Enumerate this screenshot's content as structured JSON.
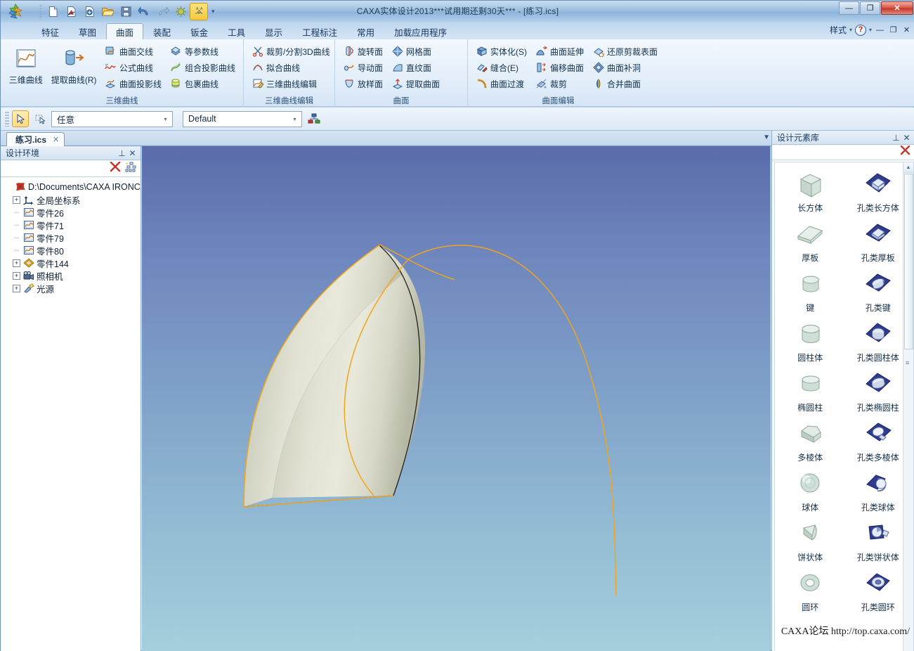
{
  "window": {
    "title": "CAXA实体设计2013***试用期还剩30天*** - [练习.ics]",
    "minimize": "—",
    "maximize": "❐",
    "close": "✕"
  },
  "quick_access": {
    "items": [
      {
        "name": "new-document-icon",
        "tip": "新建"
      },
      {
        "name": "new-part-icon",
        "tip": "新建零件"
      },
      {
        "name": "new-drawing-icon",
        "tip": "新建图纸"
      },
      {
        "name": "open-icon",
        "tip": "打开"
      },
      {
        "name": "save-icon",
        "tip": "保存"
      },
      {
        "name": "undo-icon",
        "tip": "撤销"
      },
      {
        "name": "redo-icon",
        "tip": "重做"
      },
      {
        "name": "render-icon",
        "tip": "渲染"
      },
      {
        "name": "smart-dimension-icon",
        "tip": "智能标注"
      }
    ],
    "more": "▾"
  },
  "ribbon": {
    "tabs": [
      {
        "label": "特征",
        "active": false
      },
      {
        "label": "草图",
        "active": false
      },
      {
        "label": "曲面",
        "active": true
      },
      {
        "label": "装配",
        "active": false
      },
      {
        "label": "钣金",
        "active": false
      },
      {
        "label": "工具",
        "active": false
      },
      {
        "label": "显示",
        "active": false
      },
      {
        "label": "工程标注",
        "active": false
      },
      {
        "label": "常用",
        "active": false
      },
      {
        "label": "加载应用程序",
        "active": false
      }
    ],
    "right": {
      "style_label": "样式",
      "style_arrow": "▾",
      "help_glyph": "?",
      "help_arrow": "▾",
      "min": "—",
      "restore": "❐",
      "close": "✕"
    },
    "groups": [
      {
        "title": "三维曲线",
        "big": [
          {
            "label": "三维曲线",
            "icon": "curve3d-icon"
          },
          {
            "label": "提取曲线(R)",
            "icon": "extract-curve-icon"
          }
        ],
        "cols": [
          [
            {
              "label": "曲面交线",
              "icon": "surface-intersect-icon"
            },
            {
              "label": "公式曲线",
              "icon": "formula-curve-icon"
            },
            {
              "label": "曲面投影线",
              "icon": "surface-projection-icon"
            }
          ],
          [
            {
              "label": "等参数线",
              "icon": "isoparm-icon"
            },
            {
              "label": "组合投影曲线",
              "icon": "combined-projection-icon"
            },
            {
              "label": "包裹曲线",
              "icon": "wrap-curve-icon"
            }
          ]
        ]
      },
      {
        "title": "三维曲线编辑",
        "big": [],
        "cols": [
          [
            {
              "label": "裁剪/分割3D曲线",
              "icon": "trim-split-3d-icon"
            },
            {
              "label": "拟合曲线",
              "icon": "fit-curve-icon"
            },
            {
              "label": "三维曲线编辑",
              "icon": "edit-3d-curve-icon"
            }
          ]
        ]
      },
      {
        "title": "曲面",
        "big": [],
        "cols": [
          [
            {
              "label": "旋转面",
              "icon": "revolve-surface-icon"
            },
            {
              "label": "导动面",
              "icon": "sweep-surface-icon"
            },
            {
              "label": "放样面",
              "icon": "loft-surface-icon"
            }
          ],
          [
            {
              "label": "网格面",
              "icon": "mesh-surface-icon"
            },
            {
              "label": "直纹面",
              "icon": "ruled-surface-icon"
            },
            {
              "label": "提取曲面",
              "icon": "extract-surface-icon"
            }
          ]
        ]
      },
      {
        "title": "曲面编辑",
        "big": [],
        "cols": [
          [
            {
              "label": "实体化(S)",
              "icon": "solidify-icon"
            },
            {
              "label": "缝合(E)",
              "icon": "stitch-icon"
            },
            {
              "label": "曲面过渡",
              "icon": "surface-blend-icon"
            }
          ],
          [
            {
              "label": "曲面延伸",
              "icon": "extend-surface-icon"
            },
            {
              "label": "偏移曲面",
              "icon": "offset-surface-icon"
            },
            {
              "label": "裁剪",
              "icon": "trim-icon"
            }
          ],
          [
            {
              "label": "还原剪裁表面",
              "icon": "untrim-surface-icon"
            },
            {
              "label": "曲面补洞",
              "icon": "patch-hole-icon"
            },
            {
              "label": "合并曲面",
              "icon": "merge-surface-icon"
            }
          ]
        ]
      }
    ]
  },
  "select_toolbar": {
    "pointer_icon": "arrow-select-icon",
    "box_icon": "box-select-icon",
    "filter": {
      "value": "任意",
      "arrow": "▾"
    },
    "style": {
      "value": "Default",
      "arrow": "▾"
    },
    "network_icon": "assembly-tree-icon"
  },
  "doc_tabs": {
    "tabs": [
      {
        "label": "练习.ics",
        "close": "✕",
        "active": true
      }
    ],
    "dropdown": "▼"
  },
  "left_panel": {
    "title": "设计环境",
    "pin": "⊥",
    "close": "✕",
    "toolbar": [
      {
        "name": "delete-icon",
        "glyph": "✕"
      },
      {
        "name": "tree-structure-icon",
        "glyph": "⁂"
      }
    ],
    "tree": [
      {
        "label": "D:\\Documents\\CAXA IRONC/",
        "level": 0,
        "expander": "",
        "icon": "root-design-icon"
      },
      {
        "label": "全局坐标系",
        "level": 1,
        "expander": "+",
        "icon": "coordinate-system-icon"
      },
      {
        "label": "零件26",
        "level": 1,
        "expander": "",
        "icon": "part-curve-icon"
      },
      {
        "label": "零件71",
        "level": 1,
        "expander": "",
        "icon": "part-curve-icon"
      },
      {
        "label": "零件79",
        "level": 1,
        "expander": "",
        "icon": "part-curve-icon"
      },
      {
        "label": "零件80",
        "level": 1,
        "expander": "",
        "icon": "part-curve-icon"
      },
      {
        "label": "零件144",
        "level": 1,
        "expander": "+",
        "icon": "surface-part-icon"
      },
      {
        "label": "照相机",
        "level": 1,
        "expander": "+",
        "icon": "camera-icon"
      },
      {
        "label": "光源",
        "level": 1,
        "expander": "+",
        "icon": "light-icon"
      }
    ]
  },
  "right_panel": {
    "title": "设计元素库",
    "pin": "⊥",
    "close": "✕",
    "search_close": "✕",
    "scroll": {
      "up": "▲",
      "grip": "≡"
    },
    "items": [
      {
        "label": "长方体",
        "icon": "box-solid-icon",
        "kind": "solid"
      },
      {
        "label": "孔类长方体",
        "icon": "box-hole-icon",
        "kind": "hole"
      },
      {
        "label": "厚板",
        "icon": "plate-solid-icon",
        "kind": "solid"
      },
      {
        "label": "孔类厚板",
        "icon": "plate-hole-icon",
        "kind": "hole"
      },
      {
        "label": "键",
        "icon": "key-solid-icon",
        "kind": "solid"
      },
      {
        "label": "孔类键",
        "icon": "key-hole-icon",
        "kind": "hole"
      },
      {
        "label": "圆柱体",
        "icon": "cylinder-solid-icon",
        "kind": "solid"
      },
      {
        "label": "孔类圆柱体",
        "icon": "cylinder-hole-icon",
        "kind": "hole"
      },
      {
        "label": "椭圆柱",
        "icon": "ellipse-cylinder-solid-icon",
        "kind": "solid"
      },
      {
        "label": "孔类椭圆柱",
        "icon": "ellipse-cylinder-hole-icon",
        "kind": "hole"
      },
      {
        "label": "多棱体",
        "icon": "polyhedron-solid-icon",
        "kind": "solid"
      },
      {
        "label": "孔类多棱体",
        "icon": "polyhedron-hole-icon",
        "kind": "hole"
      },
      {
        "label": "球体",
        "icon": "sphere-solid-icon",
        "kind": "solid"
      },
      {
        "label": "孔类球体",
        "icon": "sphere-hole-icon",
        "kind": "hole"
      },
      {
        "label": "饼状体",
        "icon": "wedge-solid-icon",
        "kind": "solid"
      },
      {
        "label": "孔类饼状体",
        "icon": "wedge-hole-icon",
        "kind": "hole"
      },
      {
        "label": "圆环",
        "icon": "torus-solid-icon",
        "kind": "solid"
      },
      {
        "label": "孔类圆环",
        "icon": "torus-hole-icon",
        "kind": "hole"
      }
    ]
  },
  "viewport": {
    "model_name": "swept-surface-model",
    "watermark": "CAXA论坛 http://top.caxa.com/"
  }
}
